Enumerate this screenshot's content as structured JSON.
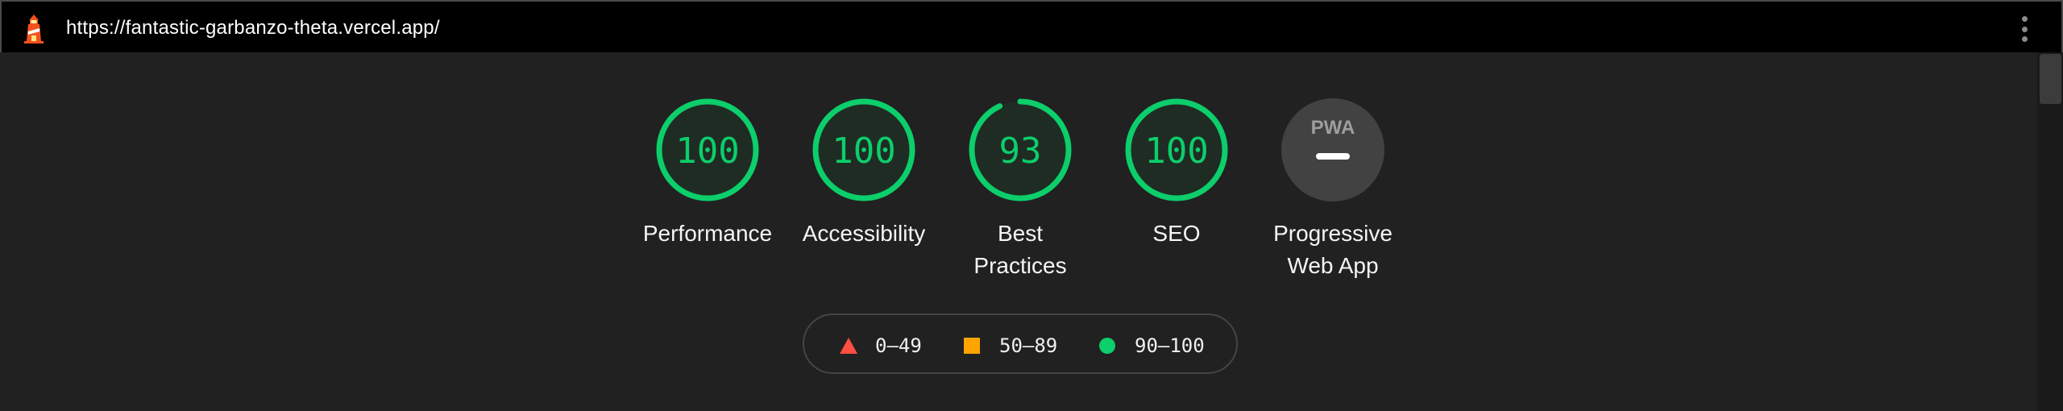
{
  "topbar": {
    "url": "https://fantastic-garbanzo-theta.vercel.app/",
    "logo_icon": "lighthouse-icon",
    "menu_icon": "kebab-menu-icon"
  },
  "colors": {
    "pass": "#0cce6b",
    "average": "#ffa400",
    "fail": "#ff4e42",
    "pwa_badge": "#424242"
  },
  "categories": [
    {
      "label": "Performance",
      "score": "100",
      "value": 100
    },
    {
      "label": "Accessibility",
      "score": "100",
      "value": 100
    },
    {
      "label": "Best Practices",
      "label_line1": "Best",
      "label_line2": "Practices",
      "score": "93",
      "value": 93
    },
    {
      "label": "SEO",
      "score": "100",
      "value": 100
    }
  ],
  "pwa": {
    "badge_text": "PWA",
    "label_line1": "Progressive",
    "label_line2": "Web App"
  },
  "legend": [
    {
      "range": "0–49",
      "icon": "red-triangle-icon"
    },
    {
      "range": "50–89",
      "icon": "orange-square-icon"
    },
    {
      "range": "90–100",
      "icon": "green-circle-icon"
    }
  ]
}
